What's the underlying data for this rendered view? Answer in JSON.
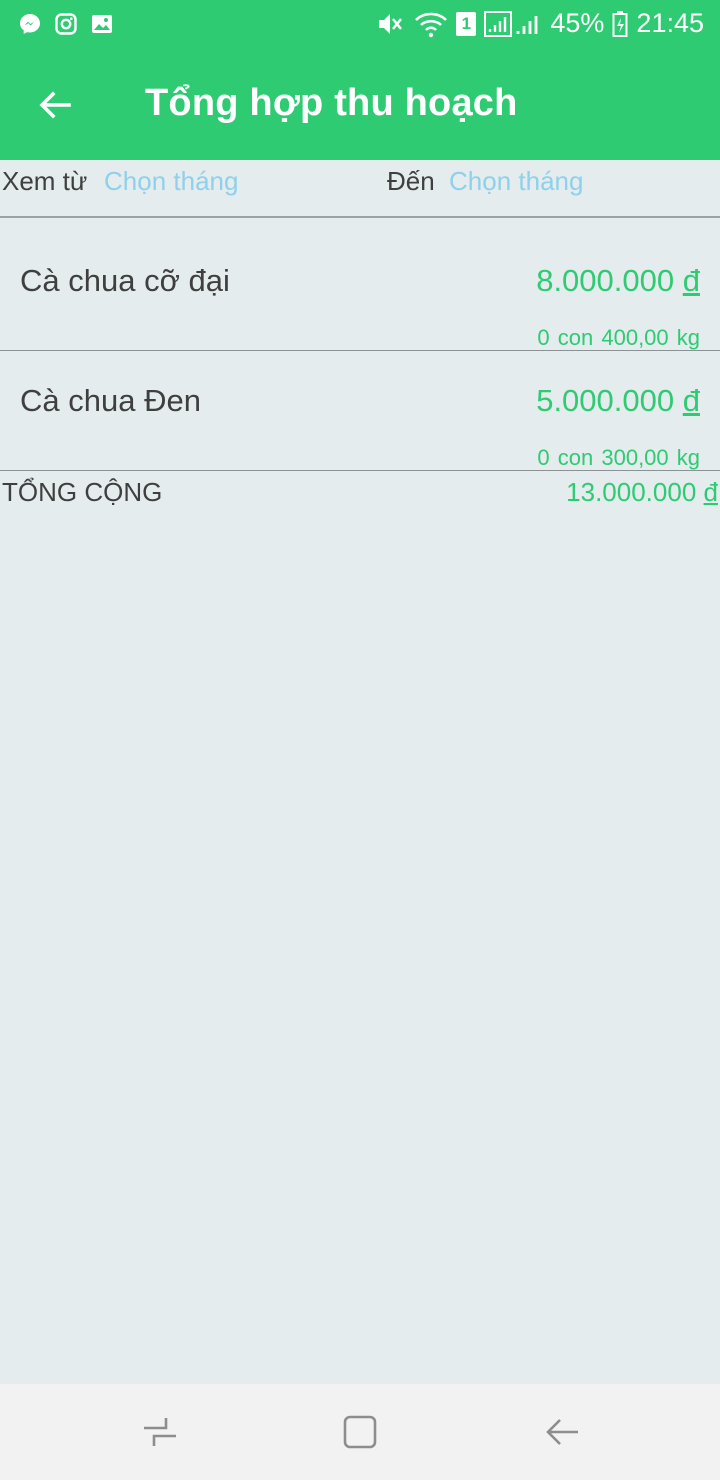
{
  "status_bar": {
    "battery": "45%",
    "time": "21:45",
    "sim_slot": "1",
    "icons": [
      "messenger-icon",
      "instagram-icon",
      "gallery-icon",
      "mute-icon",
      "wifi-icon",
      "signal-icon",
      "battery-icon"
    ]
  },
  "app_bar": {
    "title": "Tổng hợp thu hoạch"
  },
  "filter": {
    "from_label": "Xem từ",
    "from_value": "Chọn tháng",
    "to_label": "Đến",
    "to_value": "Chọn tháng"
  },
  "items": [
    {
      "name": "Cà chua cỡ đại",
      "amount": "8.000.000",
      "currency": "đ",
      "count": "0 con",
      "weight": "400,00 kg"
    },
    {
      "name": "Cà chua Đen",
      "amount": "5.000.000",
      "currency": "đ",
      "count": "0 con",
      "weight": "300,00 kg"
    }
  ],
  "total": {
    "label": "TỔNG CỘNG",
    "amount": "13.000.000",
    "currency": "đ"
  },
  "colors": {
    "primary": "#2ecb72",
    "background": "#e4ecee",
    "link": "#8fd0ec",
    "text": "#3f3f3f"
  }
}
